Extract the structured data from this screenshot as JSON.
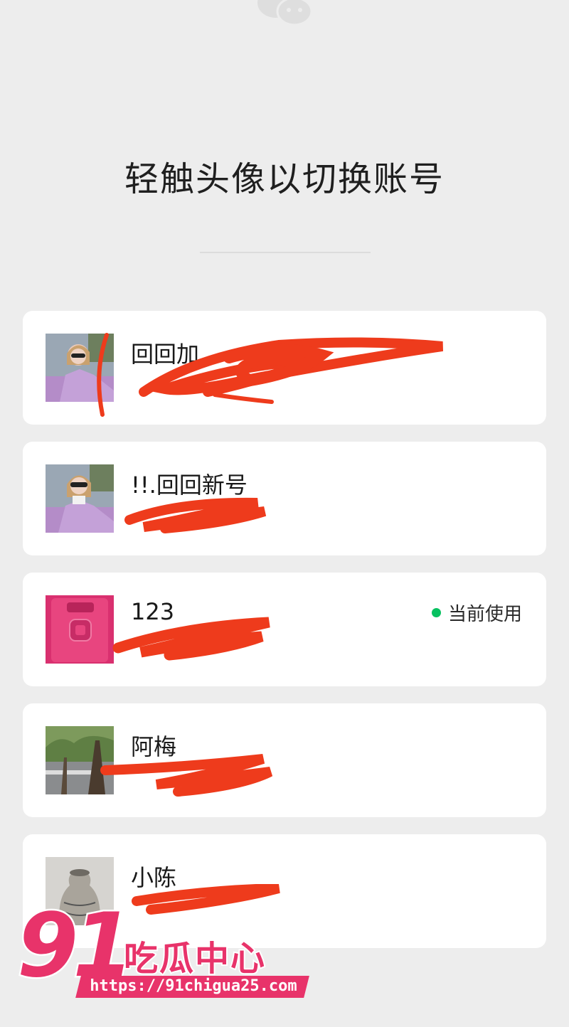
{
  "header": {
    "title": "轻触头像以切换账号"
  },
  "accounts": [
    {
      "name": "回回加",
      "sub": "",
      "current_label": ""
    },
    {
      "name": "!!.回回新号",
      "sub": "",
      "current_label": ""
    },
    {
      "name": "123",
      "sub": "",
      "current_label": "当前使用"
    },
    {
      "name": "阿梅",
      "sub": "",
      "current_label": ""
    },
    {
      "name": "小陈",
      "sub": "",
      "current_label": ""
    }
  ],
  "watermark": {
    "number": "91",
    "name": "吃瓜中心",
    "url": "https://91chigua25.com"
  },
  "colors": {
    "background": "#ededed",
    "card": "#ffffff",
    "current_dot": "#07c160",
    "redaction": "#ee3b1c",
    "watermark": "#e8336a"
  },
  "icons": {
    "top": "wechat-logo-icon",
    "current": "green-dot-icon"
  }
}
